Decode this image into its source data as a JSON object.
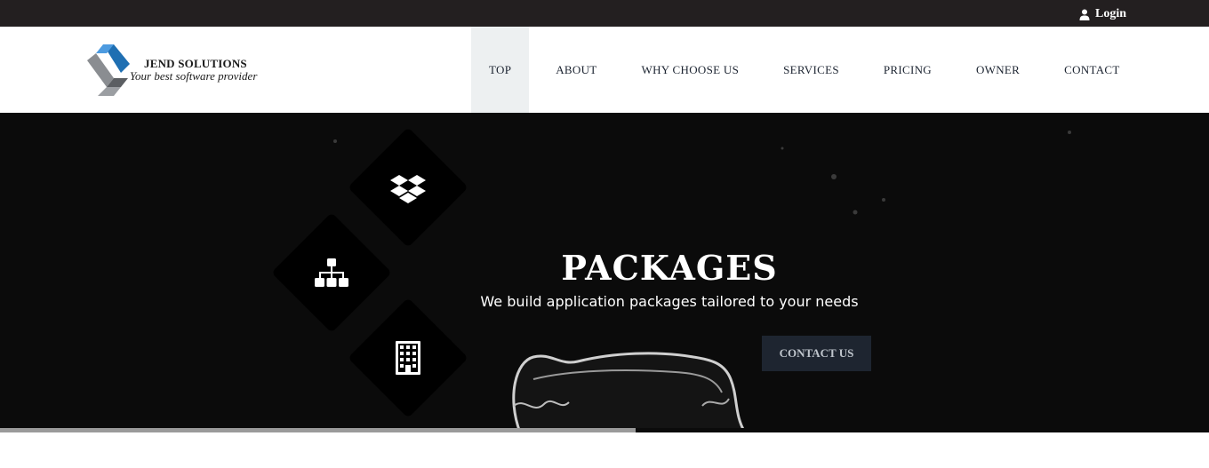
{
  "topbar": {
    "login_label": "Login",
    "login_icon": "user-icon"
  },
  "brand": {
    "name": "JEND SOLUTIONS",
    "tagline": "Your best software provider",
    "logo_colors": [
      "#1f6fb2",
      "#6a6d71"
    ]
  },
  "nav": {
    "items": [
      {
        "label": "TOP",
        "active": true
      },
      {
        "label": "ABOUT",
        "active": false
      },
      {
        "label": "WHY CHOOSE US",
        "active": false
      },
      {
        "label": "SERVICES",
        "active": false
      },
      {
        "label": "PRICING",
        "active": false
      },
      {
        "label": "OWNER",
        "active": false
      },
      {
        "label": "CONTACT",
        "active": false
      }
    ]
  },
  "hero": {
    "title": "PACKAGES",
    "subtitle": "We build application packages tailored to your needs",
    "cta_label": "CONTACT US",
    "icons": [
      "dropbox-icon",
      "sitemap-icon",
      "building-icon"
    ],
    "slide_progress": 0.526
  },
  "colors": {
    "topbar_bg": "#231f20",
    "nav_active_bg": "#edf0f1",
    "hero_bg": "#0b0b0b",
    "cta_bg": "#1e2530"
  }
}
